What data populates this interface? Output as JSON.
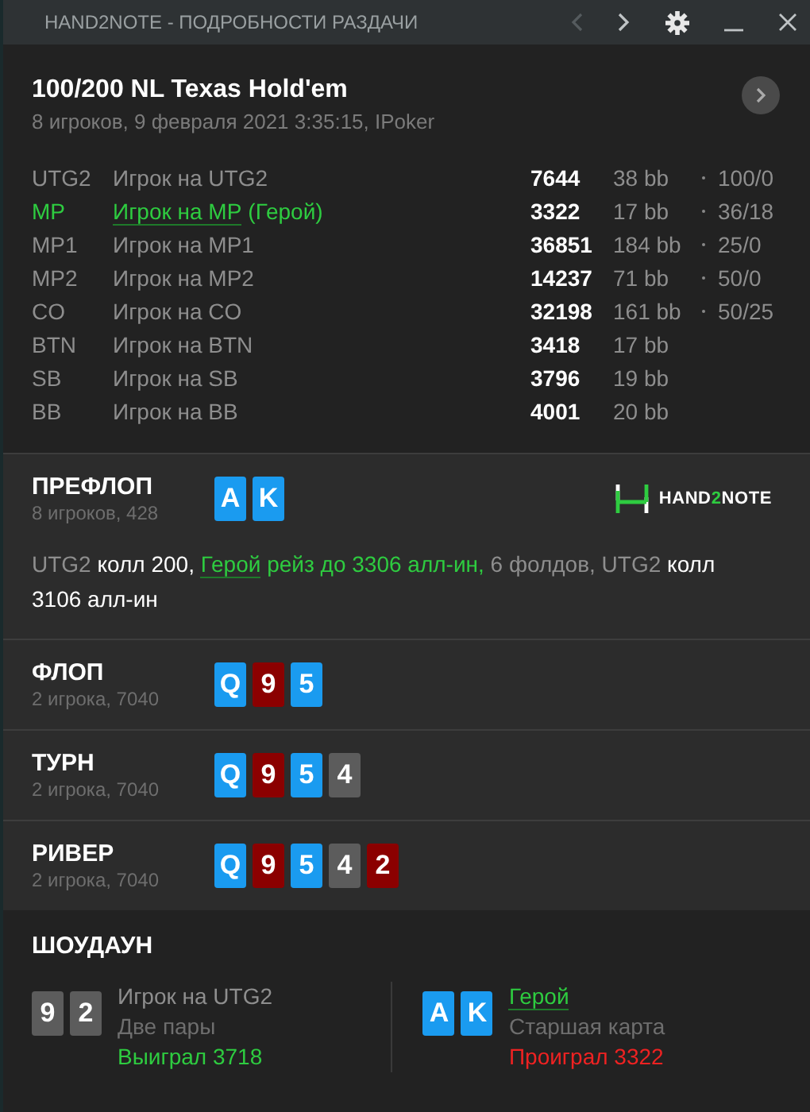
{
  "window": {
    "title": "HAND2NOTE - ПОДРОБНОСТИ РАЗДАЧИ",
    "back_disabled": true
  },
  "hand": {
    "title": "100/200 NL Texas Hold'em",
    "subtitle": "8 игроков, 9 февраля 2021 3:35:15, IPoker"
  },
  "players": [
    {
      "position": "UTG2",
      "name": "Игрок на UTG2",
      "hero": false,
      "stack": "7644",
      "bb": "38 bb",
      "stats": "100/0"
    },
    {
      "position": "MP",
      "name": "Игрок на MP",
      "hero": true,
      "hero_label": "(Герой)",
      "stack": "3322",
      "bb": "17 bb",
      "stats": "36/18"
    },
    {
      "position": "MP1",
      "name": "Игрок на MP1",
      "hero": false,
      "stack": "36851",
      "bb": "184 bb",
      "stats": "25/0"
    },
    {
      "position": "MP2",
      "name": "Игрок на MP2",
      "hero": false,
      "stack": "14237",
      "bb": "71 bb",
      "stats": "50/0"
    },
    {
      "position": "CO",
      "name": "Игрок на CO",
      "hero": false,
      "stack": "32198",
      "bb": "161 bb",
      "stats": "50/25"
    },
    {
      "position": "BTN",
      "name": "Игрок на BTN",
      "hero": false,
      "stack": "3418",
      "bb": "17 bb"
    },
    {
      "position": "SB",
      "name": "Игрок на SB",
      "hero": false,
      "stack": "3796",
      "bb": "19 bb"
    },
    {
      "position": "BB",
      "name": "Игрок на BB",
      "hero": false,
      "stack": "4001",
      "bb": "20 bb"
    }
  ],
  "logo": {
    "before": "HAND",
    "accent": "2",
    "after": "NOTE"
  },
  "streets": [
    {
      "name": "ПРЕФЛОП",
      "info": "8 игроков, 428",
      "cards": [
        {
          "rank": "A",
          "color": "#1a9bf0"
        },
        {
          "rank": "K",
          "color": "#1a9bf0"
        }
      ],
      "actions": [
        {
          "kind": "player",
          "text": "UTG2"
        },
        {
          "kind": "action",
          "text": "колл 200,"
        },
        {
          "kind": "hero",
          "text": "Герой"
        },
        {
          "kind": "hero-action",
          "text": "рейз до 3306 алл-ин,"
        },
        {
          "kind": "player",
          "text": "6 фолдов, UTG2"
        },
        {
          "kind": "action",
          "text": "колл 3106 алл-ин"
        }
      ]
    },
    {
      "name": "ФЛОП",
      "info": "2 игрока, 7040",
      "cards": [
        {
          "rank": "Q",
          "color": "#1a9bf0"
        },
        {
          "rank": "9",
          "color": "#8b0000"
        },
        {
          "rank": "5",
          "color": "#1a9bf0"
        }
      ]
    },
    {
      "name": "ТУРН",
      "info": "2 игрока, 7040",
      "cards": [
        {
          "rank": "Q",
          "color": "#1a9bf0"
        },
        {
          "rank": "9",
          "color": "#8b0000"
        },
        {
          "rank": "5",
          "color": "#1a9bf0"
        },
        {
          "rank": "4",
          "color": "#5c5c5c"
        }
      ]
    },
    {
      "name": "РИВЕР",
      "info": "2 игрока, 7040",
      "cards": [
        {
          "rank": "Q",
          "color": "#1a9bf0"
        },
        {
          "rank": "9",
          "color": "#8b0000"
        },
        {
          "rank": "5",
          "color": "#1a9bf0"
        },
        {
          "rank": "4",
          "color": "#5c5c5c"
        },
        {
          "rank": "2",
          "color": "#8b0000"
        }
      ]
    }
  ],
  "showdown": {
    "title": "ШОУДАУН",
    "hands": [
      {
        "cards": [
          {
            "rank": "9",
            "color": "#5c5c5c"
          },
          {
            "rank": "2",
            "color": "#5c5c5c"
          }
        ],
        "player": "Игрок на UTG2",
        "hero": false,
        "combo": "Две пары",
        "result": "Выиграл 3718",
        "won": true
      },
      {
        "cards": [
          {
            "rank": "A",
            "color": "#1a9bf0"
          },
          {
            "rank": "K",
            "color": "#1a9bf0"
          }
        ],
        "player": "Герой",
        "hero": true,
        "combo": "Старшая карта",
        "result": "Проиграл 3322",
        "won": false
      }
    ]
  }
}
